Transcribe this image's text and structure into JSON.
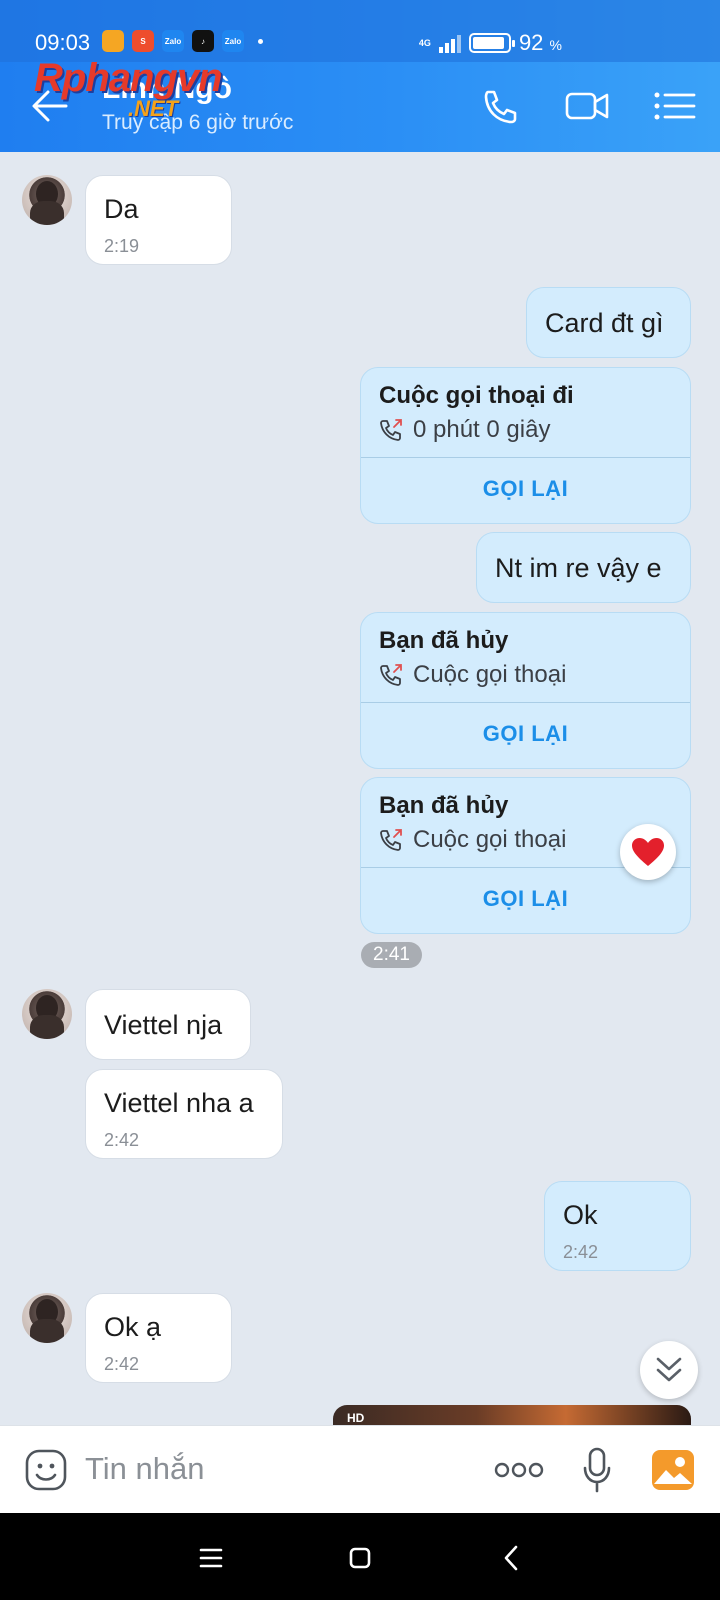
{
  "status_bar": {
    "time": "09:03",
    "apps": [
      {
        "icon": "notes-app-icon",
        "label": "",
        "color": "#f5a623"
      },
      {
        "icon": "shopee-app-icon",
        "label": "S",
        "color": "#ee4d2d"
      },
      {
        "icon": "zalo-app-icon",
        "label": "Zalo",
        "color": "#1f86f0"
      },
      {
        "icon": "tiktok-app-icon",
        "label": "♪",
        "color": "#111111"
      },
      {
        "icon": "zalo-app-icon",
        "label": "Zalo",
        "color": "#1f86f0"
      }
    ],
    "network": "4G",
    "battery_percent": 92,
    "battery_text": "92",
    "battery_unit": "%"
  },
  "header": {
    "contact_name": "Linh Ngô",
    "contact_status": "Truy cập 6 giờ trước",
    "watermark_main": "Rphangvn",
    "watermark_sub": ".NET"
  },
  "messages": {
    "m1_text": "Da",
    "m1_time": "2:19",
    "m2_text": "Card đt gì",
    "call1": {
      "title": "Cuộc gọi thoại đi",
      "sub": "0 phút 0 giây",
      "action": "GỌI LẠI"
    },
    "m3_text": "Nt im re vậy e",
    "call2": {
      "title": "Bạn đã hủy",
      "sub": "Cuộc gọi thoại",
      "action": "GỌI LẠI"
    },
    "call3": {
      "title": "Bạn đã hủy",
      "sub": "Cuộc gọi thoại",
      "action": "GỌI LẠI"
    },
    "time_separator": "2:41",
    "m4_text": "Viettel nja",
    "m5_text": "Viettel nha a",
    "m5_time": "2:42",
    "m6_text": "Ok",
    "m6_time": "2:42",
    "m7_text": "Ok ạ",
    "m7_time": "2:42",
    "media_badge": "HD"
  },
  "composer": {
    "placeholder": "Tin nhắn"
  },
  "colors": {
    "header_blue": "#2b8ff5",
    "outgoing_bubble": "#d3ecfd",
    "action_blue": "#1b8ee8",
    "chat_background": "#e2e8f0"
  }
}
